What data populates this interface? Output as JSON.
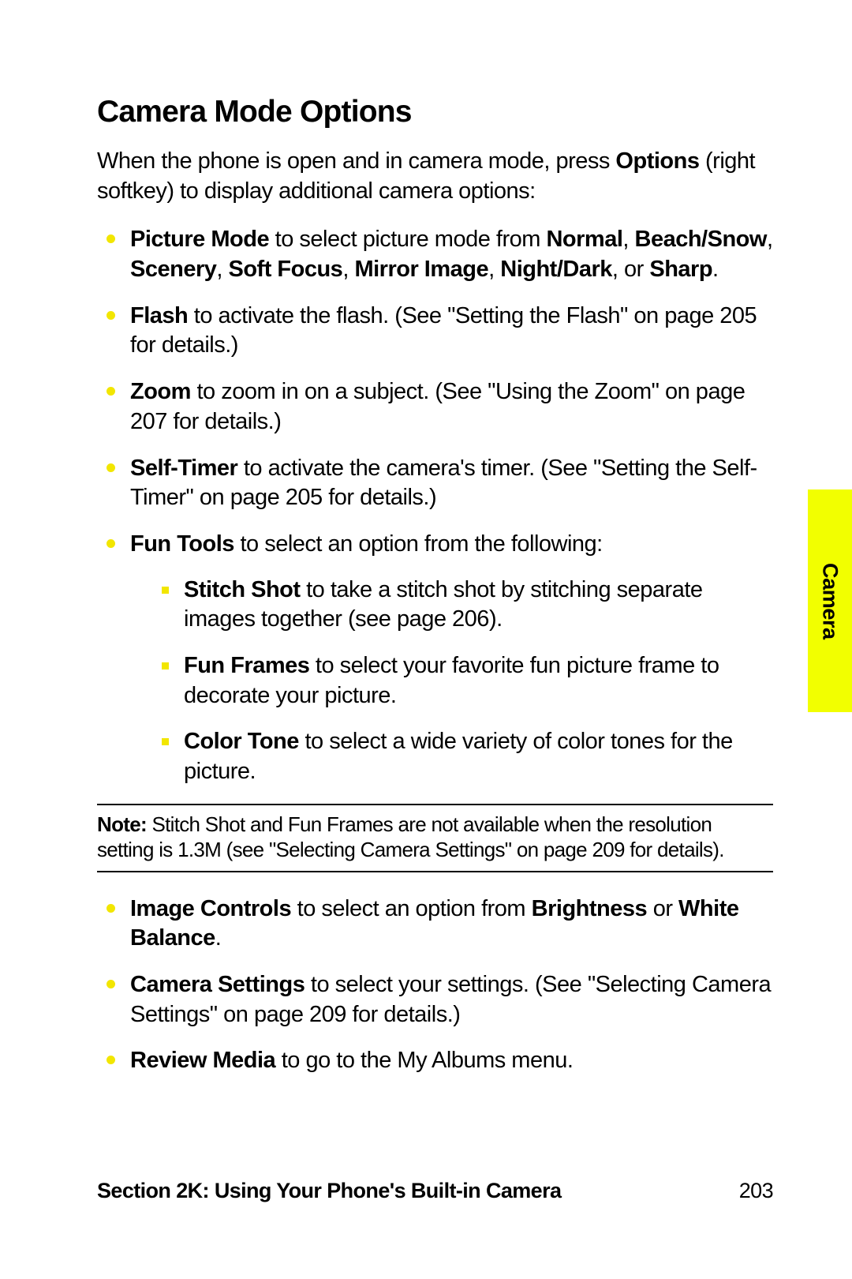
{
  "title": "Camera Mode Options",
  "intro_plain1": "When the phone is open and in camera mode, press ",
  "intro_bold1": "Options",
  "intro_plain2": " (right softkey) to display additional camera options:",
  "items": {
    "picture_mode": {
      "lead": "Picture Mode",
      "mid1": " to select picture mode from ",
      "b1": "Normal",
      "s1": ", ",
      "b2": "Beach/Snow",
      "s2": ", ",
      "b3": "Scenery",
      "s3": ", ",
      "b4": "Soft Focus",
      "s4": ", ",
      "b5": "Mirror Image",
      "s5": ", ",
      "b6": "Night/Dark",
      "s6": ", or ",
      "b7": "Sharp",
      "s7": "."
    },
    "flash": {
      "lead": "Flash",
      "rest": " to activate the flash. (See \"Setting the Flash\" on page 205 for details.)"
    },
    "zoom": {
      "lead": "Zoom",
      "rest": " to zoom in on a subject. (See \"Using the Zoom\" on page 207 for details.)"
    },
    "selftimer": {
      "lead": "Self-Timer",
      "rest": " to activate the camera's timer. (See \"Setting the Self-Timer\" on page 205 for details.)"
    },
    "funtools": {
      "lead": "Fun Tools",
      "rest": " to select an option from the following:",
      "sub": {
        "stitch": {
          "lead": "Stitch Shot",
          "rest": " to take a stitch shot by stitching separate images together (see page 206)."
        },
        "frames": {
          "lead": "Fun Frames",
          "rest": " to select your favorite fun picture frame to decorate your picture."
        },
        "color": {
          "lead": "Color Tone",
          "rest": " to select a wide variety of color tones for the picture."
        }
      }
    },
    "imagecontrols": {
      "lead": "Image Controls",
      "mid": " to select an option from ",
      "b1": "Brightness",
      "s1": " or ",
      "b2": "White Balance",
      "s2": "."
    },
    "camerasettings": {
      "lead": "Camera Settings",
      "rest": " to select your settings. (See \"Selecting Camera Settings\" on page 209 for details.)"
    },
    "reviewmedia": {
      "lead": "Review Media",
      "rest": " to go to the My Albums menu."
    }
  },
  "note": {
    "lead": "Note:",
    "rest": " Stitch Shot and Fun Frames are not available when the resolution setting is 1.3M (see \"Selecting Camera Settings\" on page 209 for details)."
  },
  "side_tab": "Camera",
  "footer_section": "Section 2K: Using Your Phone's Built-in Camera",
  "footer_page": "203"
}
